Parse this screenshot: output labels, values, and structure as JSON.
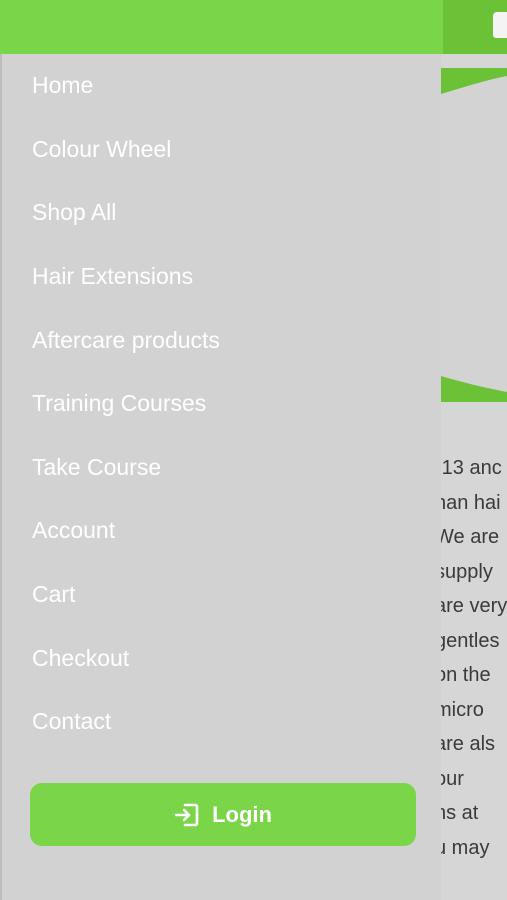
{
  "menu": {
    "items": [
      {
        "label": "Home"
      },
      {
        "label": "Colour Wheel"
      },
      {
        "label": "Shop All"
      },
      {
        "label": "Hair Extensions"
      },
      {
        "label": "Aftercare products"
      },
      {
        "label": "Training Courses"
      },
      {
        "label": "Take Course"
      },
      {
        "label": "Account"
      },
      {
        "label": "Cart"
      },
      {
        "label": "Checkout"
      },
      {
        "label": "Contact"
      }
    ]
  },
  "login": {
    "label": "Login",
    "icon": "login-icon"
  },
  "background": {
    "text_lines": [
      ")13 anc",
      "nan hai",
      " We are",
      " supply",
      "are very",
      "gentles",
      "on the",
      " micro",
      " are als",
      "our",
      "ns at",
      "u may"
    ]
  },
  "colors": {
    "accent_green": "#7ad548",
    "drawer_bg": "#d2d2d2"
  }
}
